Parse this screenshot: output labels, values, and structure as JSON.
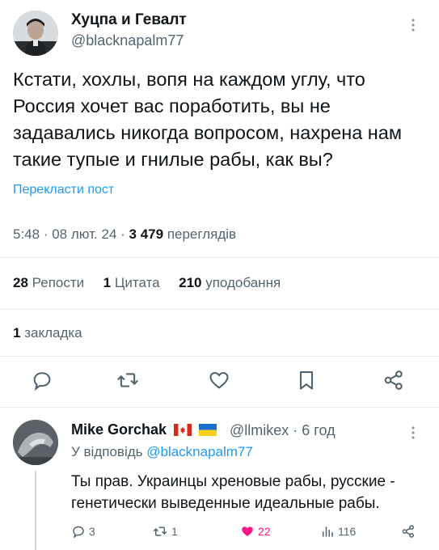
{
  "tweet": {
    "author_name": "Хуцпа и Гевалт",
    "author_handle": "@blacknapalm77",
    "more_icon": "more-dots-icon",
    "text": "Кстати, хохлы, вопя на каждом углу, что Россия хочет вас поработить, вы не задавались никогда вопросом, нахрена нам такие тупые и гнилые рабы, как вы?",
    "translate_label": "Перекласти пост",
    "time": "5:48",
    "date": "08 лют. 24",
    "views_count": "3 479",
    "views_label": "переглядів"
  },
  "stats": {
    "reposts_count": "28",
    "reposts_label": "Репости",
    "quotes_count": "1",
    "quotes_label": "Цитата",
    "likes_count": "210",
    "likes_label": "уподобання",
    "bookmarks_count": "1",
    "bookmarks_label": "закладка"
  },
  "actions": [
    "reply-icon",
    "repost-icon",
    "like-icon",
    "bookmark-icon",
    "share-icon"
  ],
  "reply": {
    "author_name": "Mike Gorchak",
    "author_handle": "@llmikex",
    "age": "6 год",
    "replying_prefix": "У відповідь",
    "replying_to": "@blacknapalm77",
    "text": "Ты прав. Украинцы хреновые рабы, русские - генетически выведенные идеальные рабы.",
    "replies": "3",
    "reposts": "1",
    "likes": "22",
    "views": "116",
    "like_color": "#f91880"
  }
}
